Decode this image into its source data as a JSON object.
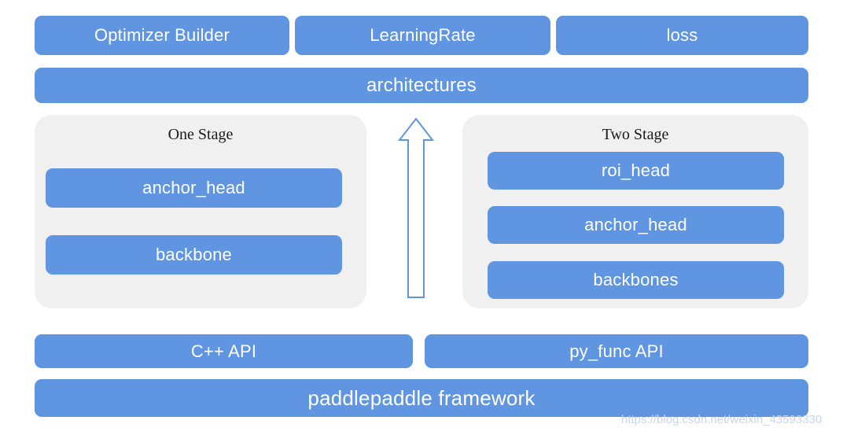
{
  "diagram": {
    "title": "PaddleDetection architecture stack",
    "colors": {
      "module_blue": "#6095e2",
      "panel_gray": "#f0f0f0",
      "background": "#ffffff",
      "module_text": "#ffffff",
      "panel_title_text": "#1a1a1a",
      "arrow_stroke": "#6095e2",
      "watermark_text": "#c9d6ea"
    },
    "top_row": [
      {
        "label": "Optimizer Builder"
      },
      {
        "label": "LearningRate"
      },
      {
        "label": "loss"
      }
    ],
    "architectures": {
      "label": "architectures"
    },
    "stages": [
      {
        "title": "One Stage",
        "modules": [
          {
            "label": "anchor_head"
          },
          {
            "label": "backbone"
          }
        ]
      },
      {
        "title": "Two Stage",
        "modules": [
          {
            "label": "roi_head"
          },
          {
            "label": "anchor_head"
          },
          {
            "label": "backbones"
          }
        ]
      }
    ],
    "arrow": {
      "icon": "arrow-up-icon",
      "direction": "up"
    },
    "api_row": [
      {
        "label": "C++  API"
      },
      {
        "label": "py_func  API"
      }
    ],
    "framework": {
      "label": "paddlepaddle framework"
    },
    "watermark": {
      "text": "https://blog.csdn.net/weixin_43593330"
    }
  }
}
